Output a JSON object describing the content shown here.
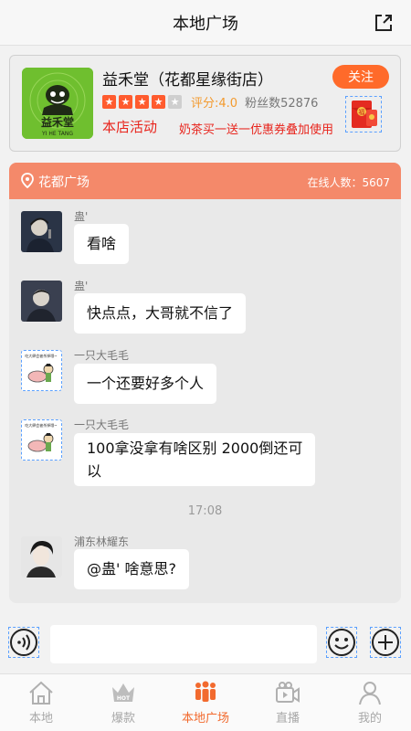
{
  "topbar": {
    "title": "本地广场"
  },
  "store": {
    "name": "益禾堂（花都星缘街店）",
    "logo_text": "益禾堂",
    "logo_sub": "YI HE TANG",
    "follow_label": "关注",
    "stars_filled": 4,
    "stars_total": 5,
    "score": "评分:4.0",
    "fans": "粉丝数52876",
    "activity_label": "本店活动",
    "activity_text": "奶茶买一送一优惠券叠加使用",
    "redpacket_char": "福"
  },
  "chat": {
    "plaza_name": "花都广场",
    "online": "在线人数：5607",
    "timestamp": "17:08",
    "messages": [
      {
        "nick": "蛊'",
        "text": "看啥"
      },
      {
        "nick": "蛊'",
        "text": "快点点，大哥就不信了"
      },
      {
        "nick": "一只大毛毛",
        "text": "一个还要好多个人"
      },
      {
        "nick": "一只大毛毛",
        "text_line1": "100拿没拿有啥区别 2000倒还可",
        "text_line2": "以"
      },
      {
        "nick": "浦东林耀东",
        "text": "@蛊' 啥意思?"
      }
    ],
    "sticker_caption": "吃大肆会被杀掉哦~"
  },
  "input": {
    "placeholder": ""
  },
  "tabs": [
    {
      "label": "本地",
      "icon": "home-icon"
    },
    {
      "label": "爆款",
      "icon": "hot-crown-icon"
    },
    {
      "label": "本地广场",
      "icon": "people-group-icon"
    },
    {
      "label": "直播",
      "icon": "video-camera-icon"
    },
    {
      "label": "我的",
      "icon": "user-icon"
    }
  ],
  "colors": {
    "accent": "#f26a2e",
    "header": "#f4896a",
    "red": "#e8241c",
    "score": "#f39a2e"
  }
}
